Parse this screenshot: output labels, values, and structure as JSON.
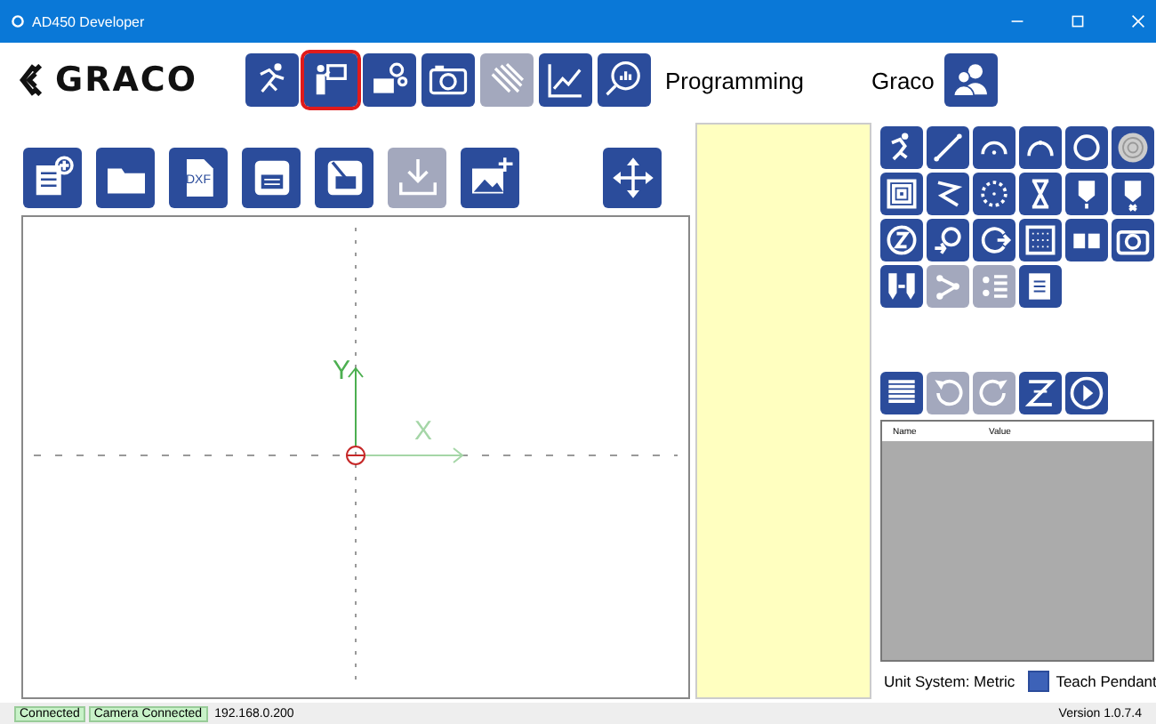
{
  "window": {
    "title": "AD450 Developer"
  },
  "header": {
    "logo": "GRACO",
    "nav": [
      {
        "disabled": false,
        "selected": false
      },
      {
        "disabled": false,
        "selected": true
      },
      {
        "disabled": false,
        "selected": false
      },
      {
        "disabled": false,
        "selected": false
      },
      {
        "disabled": true,
        "selected": false
      },
      {
        "disabled": false,
        "selected": false
      },
      {
        "disabled": false,
        "selected": false
      }
    ],
    "mode": "Programming",
    "user": "Graco"
  },
  "file_toolbar": [
    {
      "disabled": false
    },
    {
      "disabled": false
    },
    {
      "disabled": false,
      "label": "DXF"
    },
    {
      "disabled": false
    },
    {
      "disabled": false
    },
    {
      "disabled": true
    },
    {
      "disabled": false
    }
  ],
  "canvas": {
    "y_label": "Y",
    "x_label": "X"
  },
  "tools": [
    {
      "disabled": false
    },
    {
      "disabled": false
    },
    {
      "disabled": false
    },
    {
      "disabled": false
    },
    {
      "disabled": false
    },
    {
      "disabled": false
    },
    {
      "disabled": false
    },
    {
      "disabled": false
    },
    {
      "disabled": false
    },
    {
      "disabled": false
    },
    {
      "disabled": false
    },
    {
      "disabled": false
    },
    {
      "disabled": false
    },
    {
      "disabled": false
    },
    {
      "disabled": false
    },
    {
      "disabled": false
    },
    {
      "disabled": false
    },
    {
      "disabled": false
    },
    {
      "disabled": false
    },
    {
      "disabled": true
    },
    {
      "disabled": true
    },
    {
      "disabled": false
    }
  ],
  "actions": [
    {
      "disabled": false
    },
    {
      "disabled": true
    },
    {
      "disabled": true
    },
    {
      "disabled": false
    },
    {
      "disabled": false
    }
  ],
  "properties": {
    "columns": [
      "Name",
      "Value"
    ]
  },
  "unit_system": "Unit System: Metric",
  "teach_pendant": {
    "label": "Teach Pendant",
    "checked": true
  },
  "status_bar": [
    {
      "kind": "badge",
      "text": "Connected"
    },
    {
      "kind": "badge",
      "text": "Camera Connected"
    },
    {
      "kind": "text",
      "text": "192.168.0.200"
    },
    {
      "kind": "version",
      "text": "Version 1.0.7.4"
    }
  ]
}
